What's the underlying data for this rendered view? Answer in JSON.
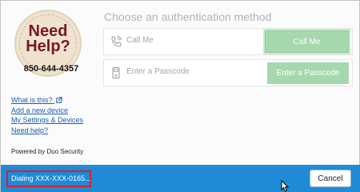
{
  "left_panel": {
    "logo": {
      "line1": "Need",
      "line2": "Help?",
      "phone": "850-644-4357"
    },
    "links": [
      {
        "label": "What is this?",
        "icon": "external-link-icon"
      },
      {
        "label": "Add a new device"
      },
      {
        "label": "My Settings & Devices"
      },
      {
        "label": "Need help?"
      }
    ],
    "powered_by": "Powered by Duo Security"
  },
  "main": {
    "heading": "Choose an authentication method",
    "methods": [
      {
        "icon": "phone-call-icon",
        "label": "Call Me",
        "button": "Call Me"
      },
      {
        "icon": "passcode-device-icon",
        "label": "Enter a Passcode",
        "button": "Enter a Passcode"
      }
    ]
  },
  "status_bar": {
    "message": "Dialing XXX-XXX-0165...",
    "cancel_label": "Cancel"
  },
  "colors": {
    "accent_blue": "#1f8ad6",
    "button_green": "#a6d8ad",
    "highlight_red": "#d9202a",
    "logo_maroon": "#7a1626",
    "link_blue": "#1a5fb4"
  }
}
